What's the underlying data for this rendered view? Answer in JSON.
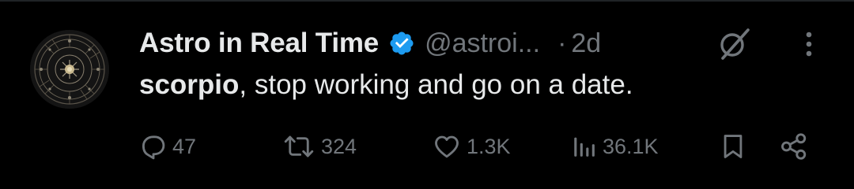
{
  "post": {
    "author": {
      "display_name": "Astro in Real Time",
      "handle": "@astroi...",
      "verified": true,
      "avatar_icon": "zodiac-wheel-avatar"
    },
    "separator": "·",
    "timestamp": "2d",
    "text": {
      "bold_part": "scorpio",
      "rest": ", stop working and go on a date."
    },
    "actions": {
      "replies": "47",
      "reposts": "324",
      "likes": "1.3K",
      "views": "36.1K"
    },
    "icons": {
      "reply": "reply-bubble-icon",
      "repost": "repost-arrows-icon",
      "like": "heart-icon",
      "views": "analytics-bars-icon",
      "bookmark": "bookmark-icon",
      "share": "share-icon",
      "grok": "grok-slash-icon",
      "more": "vertical-dots-icon",
      "verified": "verified-badge-icon"
    }
  },
  "colors": {
    "background": "#000000",
    "primary_text": "#e7e9ea",
    "secondary_text": "#71767b",
    "verified_blue": "#1d9bf0"
  }
}
